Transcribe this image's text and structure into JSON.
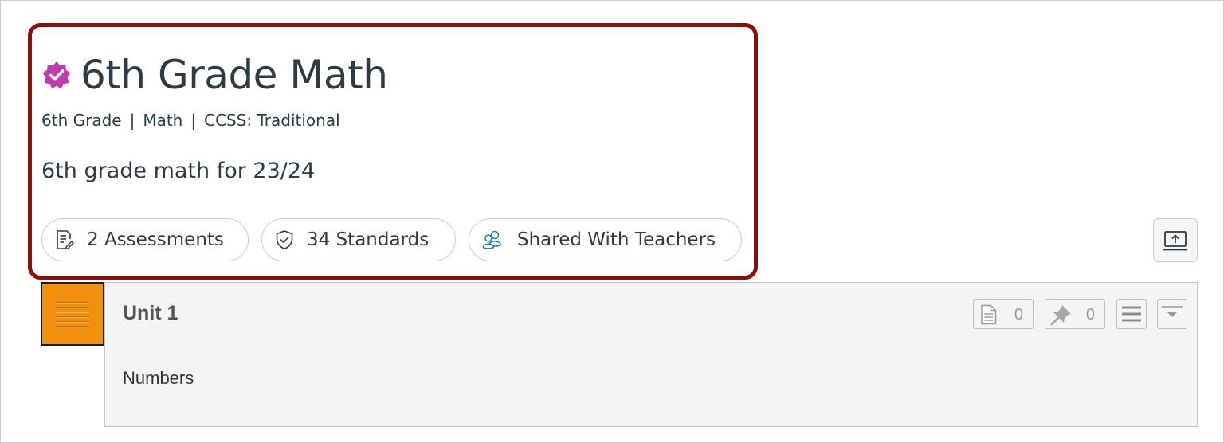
{
  "course": {
    "title": "6th Grade Math",
    "meta": [
      "6th Grade",
      "Math",
      "CCSS: Traditional"
    ],
    "meta_separator": "|",
    "description": "6th grade math for 23/24",
    "verified_icon": "verified-badge-icon",
    "badge_color": "#c13bb0"
  },
  "pills": {
    "assessments": "2 Assessments",
    "standards": "34 Standards",
    "shared": "Shared With Teachers"
  },
  "unit": {
    "title": "Unit 1",
    "description": "Numbers",
    "pages_count": "0",
    "pins_count": "0"
  },
  "colors": {
    "highlight_border": "#8b0d0d",
    "drag_handle": "#f0900c",
    "shared_icon": "#2b7abc"
  }
}
